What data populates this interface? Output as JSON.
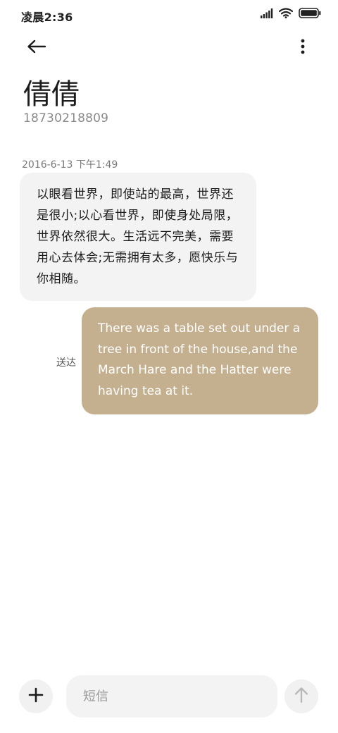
{
  "status_bar": {
    "time": "凌晨2:36",
    "icons": [
      "signal-icon",
      "wifi-icon",
      "battery-icon"
    ]
  },
  "header": {
    "back_icon": "arrow-left-icon",
    "more_icon": "more-vertical-icon"
  },
  "contact": {
    "name": "倩倩",
    "number": "18730218809"
  },
  "conversation": {
    "timestamp": "2016-6-13 下午1:49",
    "messages": [
      {
        "direction": "incoming",
        "text": "以眼看世界，即使站的最高，世界还是很小;以心看世界，即使身处局限，世界依然很大。生活远不完美，需要用心去体会;无需拥有太多，愿快乐与你相随。"
      },
      {
        "direction": "outgoing",
        "text": "There was a table set out under a tree in front of the house,and the March Hare and the Hatter were having tea at it.",
        "status": "送达"
      }
    ]
  },
  "composer": {
    "attach_icon": "plus-icon",
    "placeholder": "短信",
    "value": "",
    "send_icon": "arrow-up-icon"
  },
  "colors": {
    "background": "#ffffff",
    "incoming_bubble": "#f3f3f3",
    "outgoing_bubble": "#c4b08f",
    "outgoing_text": "#ffffff",
    "secondary_text": "#8a8a8a"
  }
}
